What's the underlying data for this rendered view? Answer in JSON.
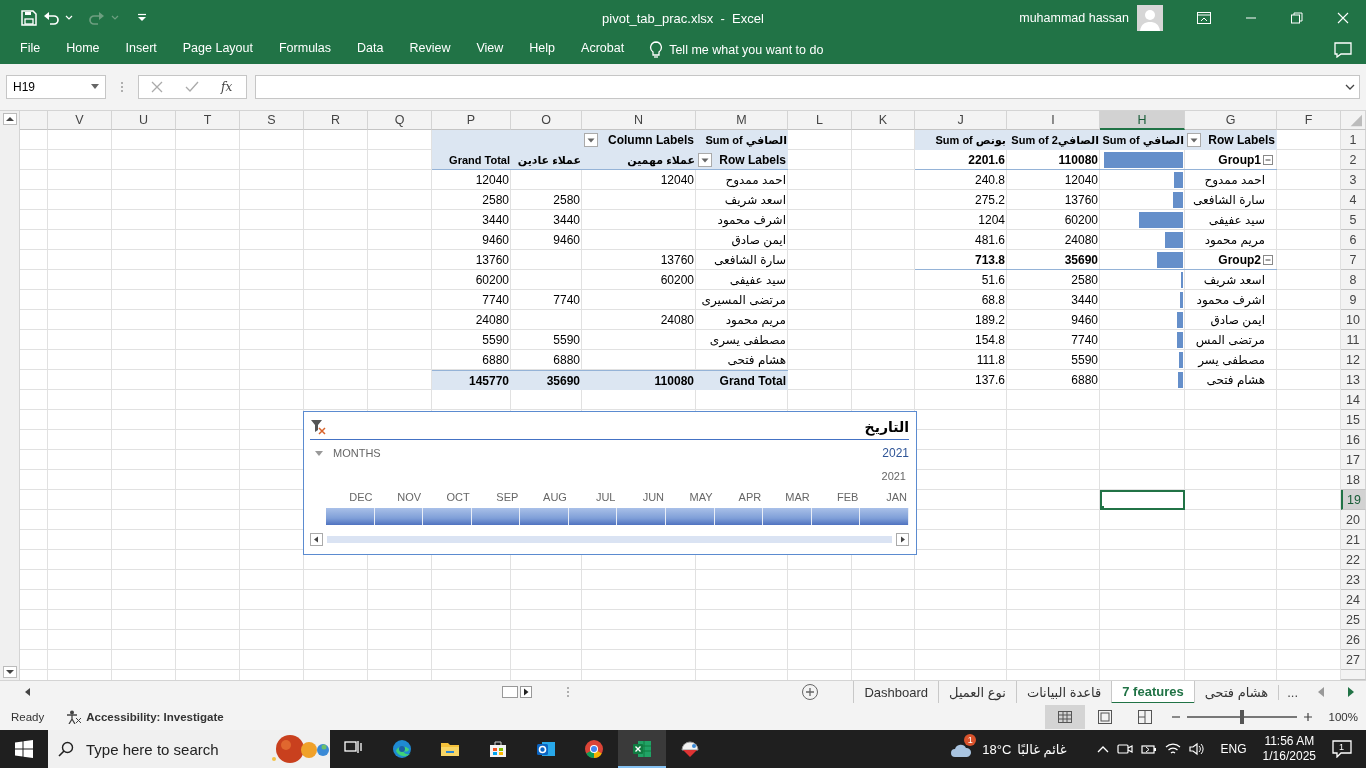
{
  "title_bar": {
    "title": "pivot_tab_prac.xlsx  -  Excel",
    "user": "muhammad hassan",
    "redo_disabled": true
  },
  "ribbon": {
    "tabs": [
      {
        "label": "File",
        "selected": false
      },
      {
        "label": "Home",
        "selected": false
      },
      {
        "label": "Insert",
        "selected": false
      },
      {
        "label": "Page Layout",
        "selected": false
      },
      {
        "label": "Formulas",
        "selected": false
      },
      {
        "label": "Data",
        "selected": false
      },
      {
        "label": "Review",
        "selected": false
      },
      {
        "label": "View",
        "selected": false
      },
      {
        "label": "Help",
        "selected": false
      },
      {
        "label": "Acrobat",
        "selected": false
      }
    ],
    "tell_me": "Tell me what you want to do"
  },
  "formula_bar": {
    "name_box": "H19",
    "function_label": "fx"
  },
  "sheet": {
    "columns": [
      {
        "label": "V",
        "selected": false
      },
      {
        "label": "U",
        "selected": false
      },
      {
        "label": "T",
        "selected": false
      },
      {
        "label": "S",
        "selected": false
      },
      {
        "label": "R",
        "selected": false
      },
      {
        "label": "Q",
        "selected": false
      },
      {
        "label": "P",
        "selected": false
      },
      {
        "label": "O",
        "selected": false
      },
      {
        "label": "N",
        "selected": false
      },
      {
        "label": "M",
        "selected": false
      },
      {
        "label": "L",
        "selected": false
      },
      {
        "label": "K",
        "selected": false
      },
      {
        "label": "J",
        "selected": false
      },
      {
        "label": "I",
        "selected": false
      },
      {
        "label": "H",
        "selected": true
      },
      {
        "label": "G",
        "selected": false
      },
      {
        "label": "F",
        "selected": false
      }
    ],
    "rows": [
      {
        "label": "1",
        "selected": false
      },
      {
        "label": "2",
        "selected": false
      },
      {
        "label": "3",
        "selected": false
      },
      {
        "label": "4",
        "selected": false
      },
      {
        "label": "5",
        "selected": false
      },
      {
        "label": "6",
        "selected": false
      },
      {
        "label": "7",
        "selected": false
      },
      {
        "label": "8",
        "selected": false
      },
      {
        "label": "9",
        "selected": false
      },
      {
        "label": "10",
        "selected": false
      },
      {
        "label": "11",
        "selected": false
      },
      {
        "label": "12",
        "selected": false
      },
      {
        "label": "13",
        "selected": false
      },
      {
        "label": "14",
        "selected": false
      },
      {
        "label": "15",
        "selected": false
      },
      {
        "label": "16",
        "selected": false
      },
      {
        "label": "17",
        "selected": false
      },
      {
        "label": "18",
        "selected": false
      },
      {
        "label": "19",
        "selected": true
      },
      {
        "label": "20",
        "selected": false
      },
      {
        "label": "21",
        "selected": false
      },
      {
        "label": "22",
        "selected": false
      },
      {
        "label": "23",
        "selected": false
      },
      {
        "label": "24",
        "selected": false
      },
      {
        "label": "25",
        "selected": false
      },
      {
        "label": "26",
        "selected": false
      },
      {
        "label": "27",
        "selected": false
      }
    ],
    "pivot_table_1": {
      "column_labels": "Column Labels",
      "corner": "Sum of الصافي",
      "row_labels": "Row Labels",
      "columns": {
        "grand_total": "Grand Total",
        "regular": "عملاء عادين",
        "important": "عملاء مهمين"
      },
      "rows": [
        {
          "label": "احمد ممدوح",
          "grand_total": "12040",
          "important": "12040"
        },
        {
          "label": "اسعد شريف",
          "grand_total": "2580",
          "regular": "2580"
        },
        {
          "label": "اشرف محمود",
          "grand_total": "3440",
          "regular": "3440"
        },
        {
          "label": "ايمن صادق",
          "grand_total": "9460",
          "regular": "9460"
        },
        {
          "label": "سارة الشافعى",
          "grand_total": "13760",
          "important": "13760"
        },
        {
          "label": "سيد عفيفى",
          "grand_total": "60200",
          "important": "60200"
        },
        {
          "label": "مرتضى المسيرى",
          "grand_total": "7740",
          "regular": "7740"
        },
        {
          "label": "مريم محمود",
          "grand_total": "24080",
          "important": "24080"
        },
        {
          "label": "مصطفى يسرى",
          "grand_total": "5590",
          "regular": "5590"
        },
        {
          "label": "هشام فتحى",
          "grand_total": "6880",
          "regular": "6880"
        }
      ],
      "grand_total": {
        "label": "Grand Total",
        "grand_total": "145770",
        "regular": "35690",
        "important": "110080"
      }
    },
    "pivot_table_2": {
      "value_headers": [
        "Sum of الصافي",
        "Sum of الصافي2",
        "Sum of بونص"
      ],
      "row_labels": "Row Labels",
      "groups": [
        {
          "label": "Group1",
          "expanded": true,
          "level": 0.97,
          "values": [
            "2201.6",
            "110080"
          ],
          "children": [
            {
              "label": "احمد ممدوح",
              "level": 0.11,
              "values": [
                "240.8",
                "12040"
              ]
            },
            {
              "label": "سارة الشافعى",
              "level": 0.12,
              "values": [
                "275.2",
                "13760"
              ]
            },
            {
              "label": "سيد عفيفى",
              "level": 0.54,
              "values": [
                "1204",
                "60200"
              ]
            },
            {
              "label": "مريم محمود",
              "level": 0.22,
              "values": [
                "481.6",
                "24080"
              ]
            }
          ]
        },
        {
          "label": "Group2",
          "expanded": true,
          "level": 0.32,
          "values": [
            "713.8",
            "35690"
          ],
          "children": [
            {
              "label": "اسعد شريف",
              "level": 0.03,
              "values": [
                "51.6",
                "2580"
              ]
            },
            {
              "label": "اشرف محمود",
              "level": 0.04,
              "values": [
                "68.8",
                "3440"
              ]
            },
            {
              "label": "ايمن صادق",
              "level": 0.08,
              "values": [
                "189.2",
                "9460"
              ]
            },
            {
              "label": "مرتضى المس",
              "level": 0.07,
              "values": [
                "154.8",
                "7740"
              ]
            },
            {
              "label": "مصطفى يسر",
              "level": 0.05,
              "values": [
                "111.8",
                "5590"
              ]
            },
            {
              "label": "هشام فتحى",
              "level": 0.06,
              "values": [
                "137.6",
                "6880"
              ]
            }
          ]
        }
      ]
    },
    "timeline": {
      "title": "التاريخ",
      "level_label": "MONTHS",
      "period": "2021",
      "year": "2021",
      "months": [
        {
          "label": "DEC",
          "selected": true
        },
        {
          "label": "NOV",
          "selected": true
        },
        {
          "label": "OCT",
          "selected": true
        },
        {
          "label": "SEP",
          "selected": true
        },
        {
          "label": "AUG",
          "selected": true
        },
        {
          "label": "JUL",
          "selected": true
        },
        {
          "label": "JUN",
          "selected": true
        },
        {
          "label": "MAY",
          "selected": true
        },
        {
          "label": "APR",
          "selected": true
        },
        {
          "label": "MAR",
          "selected": true
        },
        {
          "label": "FEB",
          "selected": true
        },
        {
          "label": "JAN",
          "selected": true
        }
      ]
    }
  },
  "sheet_tabs": {
    "tabs": [
      {
        "label": "هشام فتحى",
        "selected": false
      },
      {
        "label": "7 features",
        "selected": true
      },
      {
        "label": "قاعدة البيانات",
        "selected": false
      },
      {
        "label": "نوع العميل",
        "selected": false
      },
      {
        "label": "Dashboard",
        "selected": false
      }
    ],
    "more": "..."
  },
  "status_bar": {
    "ready": "Ready",
    "accessibility": "Accessibility: Investigate",
    "views": [
      {
        "kind": "normal",
        "selected": true
      },
      {
        "kind": "page-layout",
        "selected": false
      },
      {
        "kind": "page-break",
        "selected": false
      }
    ],
    "zoom_slider": {
      "level": 0.5
    },
    "zoom": "100%"
  },
  "taskbar": {
    "search_placeholder": "Type here to search",
    "apps": [
      {
        "kind": "task-view",
        "active": false
      },
      {
        "kind": "edge",
        "active": false
      },
      {
        "kind": "folder",
        "active": false
      },
      {
        "kind": "store",
        "active": false
      },
      {
        "kind": "mail",
        "active": false
      },
      {
        "kind": "chrome",
        "active": false
      },
      {
        "kind": "excel",
        "active": true
      },
      {
        "kind": "other",
        "active": false
      }
    ],
    "weather": {
      "badge": "1",
      "temperature": "18°C",
      "condition": "غائم غالبًا"
    },
    "language": "ENG",
    "time": "11:56 AM",
    "date": "1/16/2025",
    "notification_badge": "1"
  }
}
